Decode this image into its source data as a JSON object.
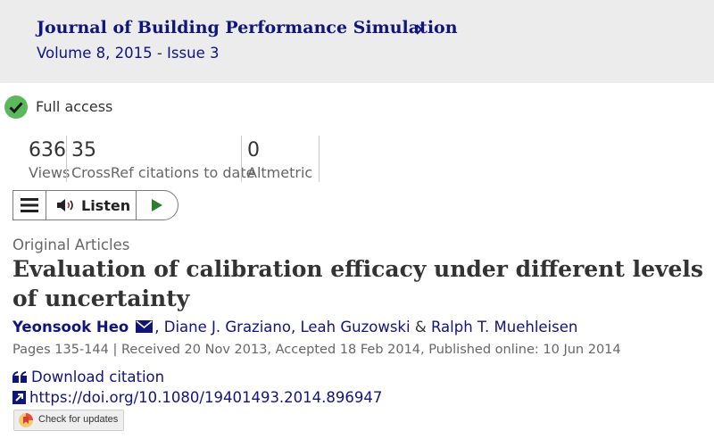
{
  "header": {
    "journal_title": "Journal of Building Performance Simulation",
    "volume_link": "Volume 8, 2015",
    "volume_sep": " - ",
    "issue_link": "Issue 3"
  },
  "access": {
    "label": "Full access",
    "icon": "check-circle-icon",
    "color": "#5cb85c"
  },
  "metrics": [
    {
      "value": "636",
      "label": "Views"
    },
    {
      "value": "35",
      "label": "CrossRef citations to date"
    },
    {
      "value": "0",
      "label": "Altmetric"
    }
  ],
  "listen_bar": {
    "menu_icon": "hamburger-icon",
    "speaker_icon": "speaker-icon",
    "label": "Listen",
    "play_icon": "play-icon"
  },
  "article": {
    "section": "Original Articles",
    "title": "Evaluation of calibration efficacy under different levels of uncertainty",
    "authors": [
      {
        "name": "Yeonsook Heo",
        "mail": true
      },
      {
        "name": "Diane J. Graziano"
      },
      {
        "name": "Leah Guzowski"
      },
      {
        "name": "Ralph T. Muehleisen"
      }
    ],
    "pages": "Pages 135-144",
    "received": "Received 20 Nov 2013, Accepted 18 Feb 2014, Published online: 10 Jun 2014"
  },
  "links": {
    "download_citation": "Download citation",
    "doi": "https://doi.org/10.1080/19401493.2014.896947",
    "check_updates": "Check for updates"
  },
  "colors": {
    "brand": "#10147e",
    "header_bg": "#ececec",
    "access_green": "#5cb85c"
  }
}
